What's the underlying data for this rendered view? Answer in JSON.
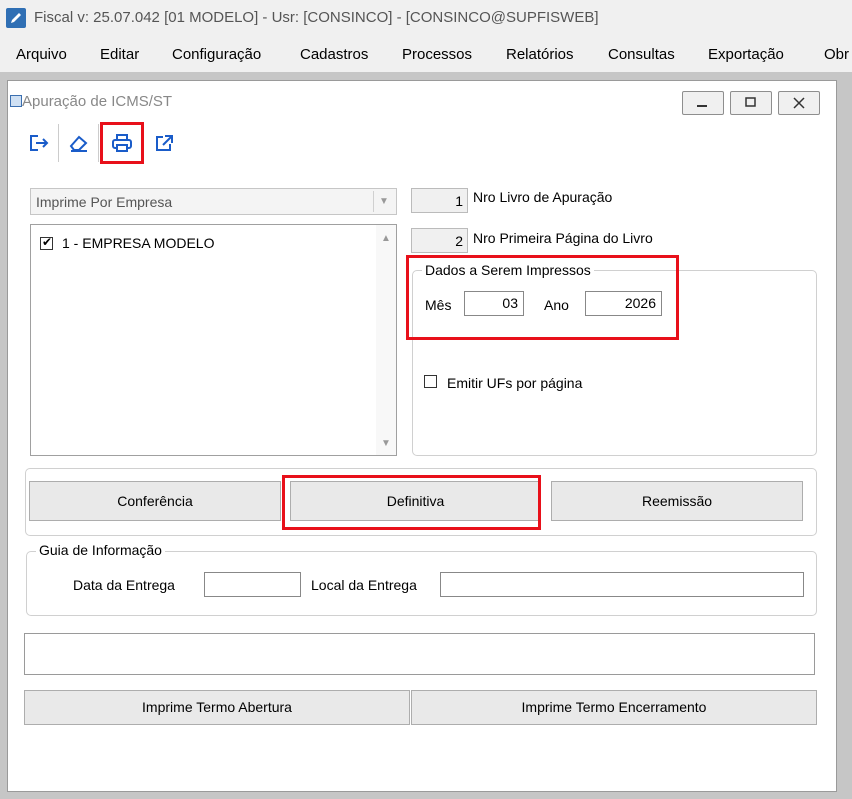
{
  "app": {
    "title": "Fiscal  v: 25.07.042   [01 MODELO] - Usr: [CONSINCO] - [CONSINCO@SUPFISWEB]"
  },
  "menu": {
    "items": [
      "Arquivo",
      "Editar",
      "Configuração",
      "Cadastros",
      "Processos",
      "Relatórios",
      "Consultas",
      "Exportação",
      "Obr"
    ]
  },
  "window": {
    "title": "Apuração de ICMS/ST"
  },
  "toolbar": {
    "icons": [
      "exit-icon",
      "eraser-icon",
      "printer-icon",
      "export-icon"
    ]
  },
  "form": {
    "print_mode": "Imprime Por Empresa",
    "companies": [
      {
        "label": "1 - EMPRESA MODELO",
        "checked": true
      }
    ],
    "nro_livro_value": "1",
    "nro_livro_label": "Nro Livro de Apuração",
    "nro_pagina_value": "2",
    "nro_pagina_label": "Nro Primeira Página do Livro",
    "dados_title": "Dados a Serem Impressos",
    "mes_label": "Mês",
    "mes_value": "03",
    "ano_label": "Ano",
    "ano_value": "2026",
    "emitir_ufs_label": "Emitir UFs por página",
    "emitir_ufs_checked": false
  },
  "actions": {
    "conferencia": "Conferência",
    "definitiva": "Definitiva",
    "reemissao": "Reemissão"
  },
  "guia": {
    "title": "Guia de Informação",
    "data_entrega_label": "Data da Entrega",
    "data_entrega_value": "",
    "local_entrega_label": "Local da Entrega",
    "local_entrega_value": ""
  },
  "footer": {
    "status_text": "",
    "termo_abertura": "Imprime Termo Abertura",
    "termo_encerramento": "Imprime Termo Encerramento"
  }
}
